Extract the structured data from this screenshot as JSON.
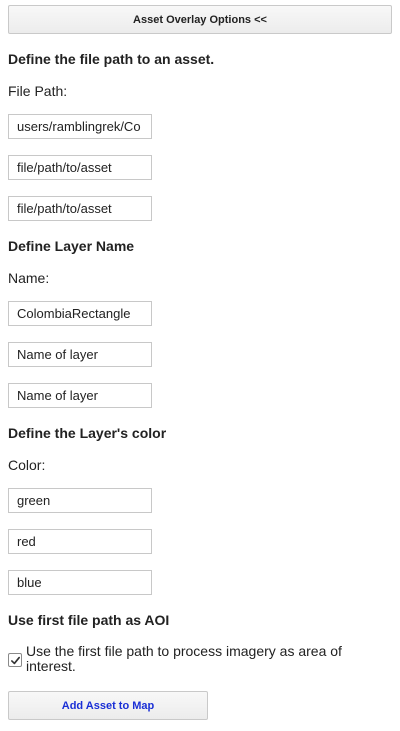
{
  "toggle_button_label": "Asset Overlay Options <<",
  "file_path": {
    "section_title": "Define the file path to an asset.",
    "label": "File Path:",
    "inputs": [
      {
        "value": "users/ramblingrek/Co",
        "placeholder": "file/path/to/asset"
      },
      {
        "value": "",
        "placeholder": "file/path/to/asset"
      },
      {
        "value": "",
        "placeholder": "file/path/to/asset"
      }
    ]
  },
  "layer_name": {
    "section_title": "Define Layer Name",
    "label": "Name:",
    "inputs": [
      {
        "value": "ColombiaRectangle",
        "placeholder": "Name of layer"
      },
      {
        "value": "",
        "placeholder": "Name of layer"
      },
      {
        "value": "",
        "placeholder": "Name of layer"
      }
    ]
  },
  "layer_color": {
    "section_title": "Define the Layer's color",
    "label": "Color:",
    "inputs": [
      {
        "value": "green",
        "placeholder": ""
      },
      {
        "value": "red",
        "placeholder": ""
      },
      {
        "value": "blue",
        "placeholder": ""
      }
    ]
  },
  "aoi": {
    "section_title": "Use first file path as AOI",
    "checkbox_checked": true,
    "checkbox_label": "Use the first file path to process imagery as area of interest."
  },
  "add_button_label": "Add Asset to Map",
  "colors": {
    "add_button_text": "#1a2fd6",
    "text": "#222222",
    "border": "#c8c8c8"
  }
}
